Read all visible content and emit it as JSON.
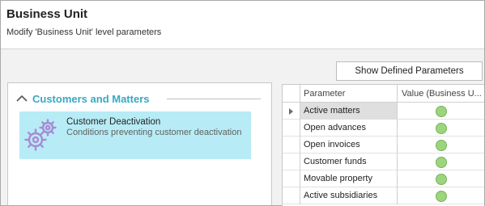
{
  "header": {
    "title": "Business Unit",
    "subtitle": "Modify 'Business Unit' level parameters"
  },
  "toolbar": {
    "show_defined_label": "Show Defined Parameters"
  },
  "group": {
    "title": "Customers and Matters",
    "icon": "chevron-up-icon",
    "color": "#36a9c4",
    "items": [
      {
        "title": "Customer Deactivation",
        "description": "Conditions preventing customer deactivation",
        "icon": "gears-icon",
        "highlight": "#b7ecf6"
      }
    ]
  },
  "grid": {
    "columns": [
      "Parameter",
      "Value (Business U..."
    ],
    "rows": [
      {
        "parameter": "Active matters",
        "value": "green-status",
        "selected": true
      },
      {
        "parameter": "Open advances",
        "value": "green-status",
        "selected": false
      },
      {
        "parameter": "Open invoices",
        "value": "green-status",
        "selected": false
      },
      {
        "parameter": "Customer funds",
        "value": "green-status",
        "selected": false
      },
      {
        "parameter": "Movable property",
        "value": "green-status",
        "selected": false
      },
      {
        "parameter": "Active subsidiaries",
        "value": "green-status",
        "selected": false
      }
    ],
    "status_color": "#9bd67f"
  }
}
